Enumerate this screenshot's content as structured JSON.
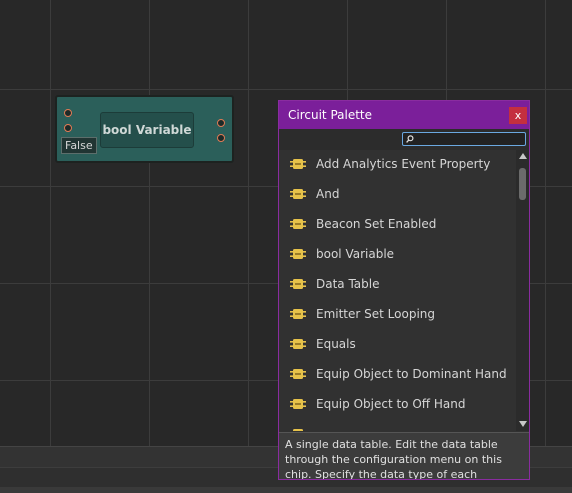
{
  "chip": {
    "title": "bool Variable",
    "false_label": "False"
  },
  "palette": {
    "title": "Circuit Palette",
    "close_label": "x",
    "search_value": "",
    "items": [
      {
        "label": "Add Analytics Event Property"
      },
      {
        "label": "And"
      },
      {
        "label": "Beacon Set Enabled"
      },
      {
        "label": "bool Variable"
      },
      {
        "label": "Data Table"
      },
      {
        "label": "Emitter Set Looping"
      },
      {
        "label": "Equals"
      },
      {
        "label": "Equip Object to Dominant Hand"
      },
      {
        "label": "Equip Object to Off Hand"
      }
    ],
    "description": "A single data table. Edit the data table through the configuration menu on this chip. Specify the data type of each"
  },
  "colors": {
    "chip_body": "#2b5f5a",
    "palette_header": "#7b1f9a",
    "close_button": "#c42f3f",
    "item_icon": "#e6c24a",
    "port_ring": "#e07a55"
  }
}
